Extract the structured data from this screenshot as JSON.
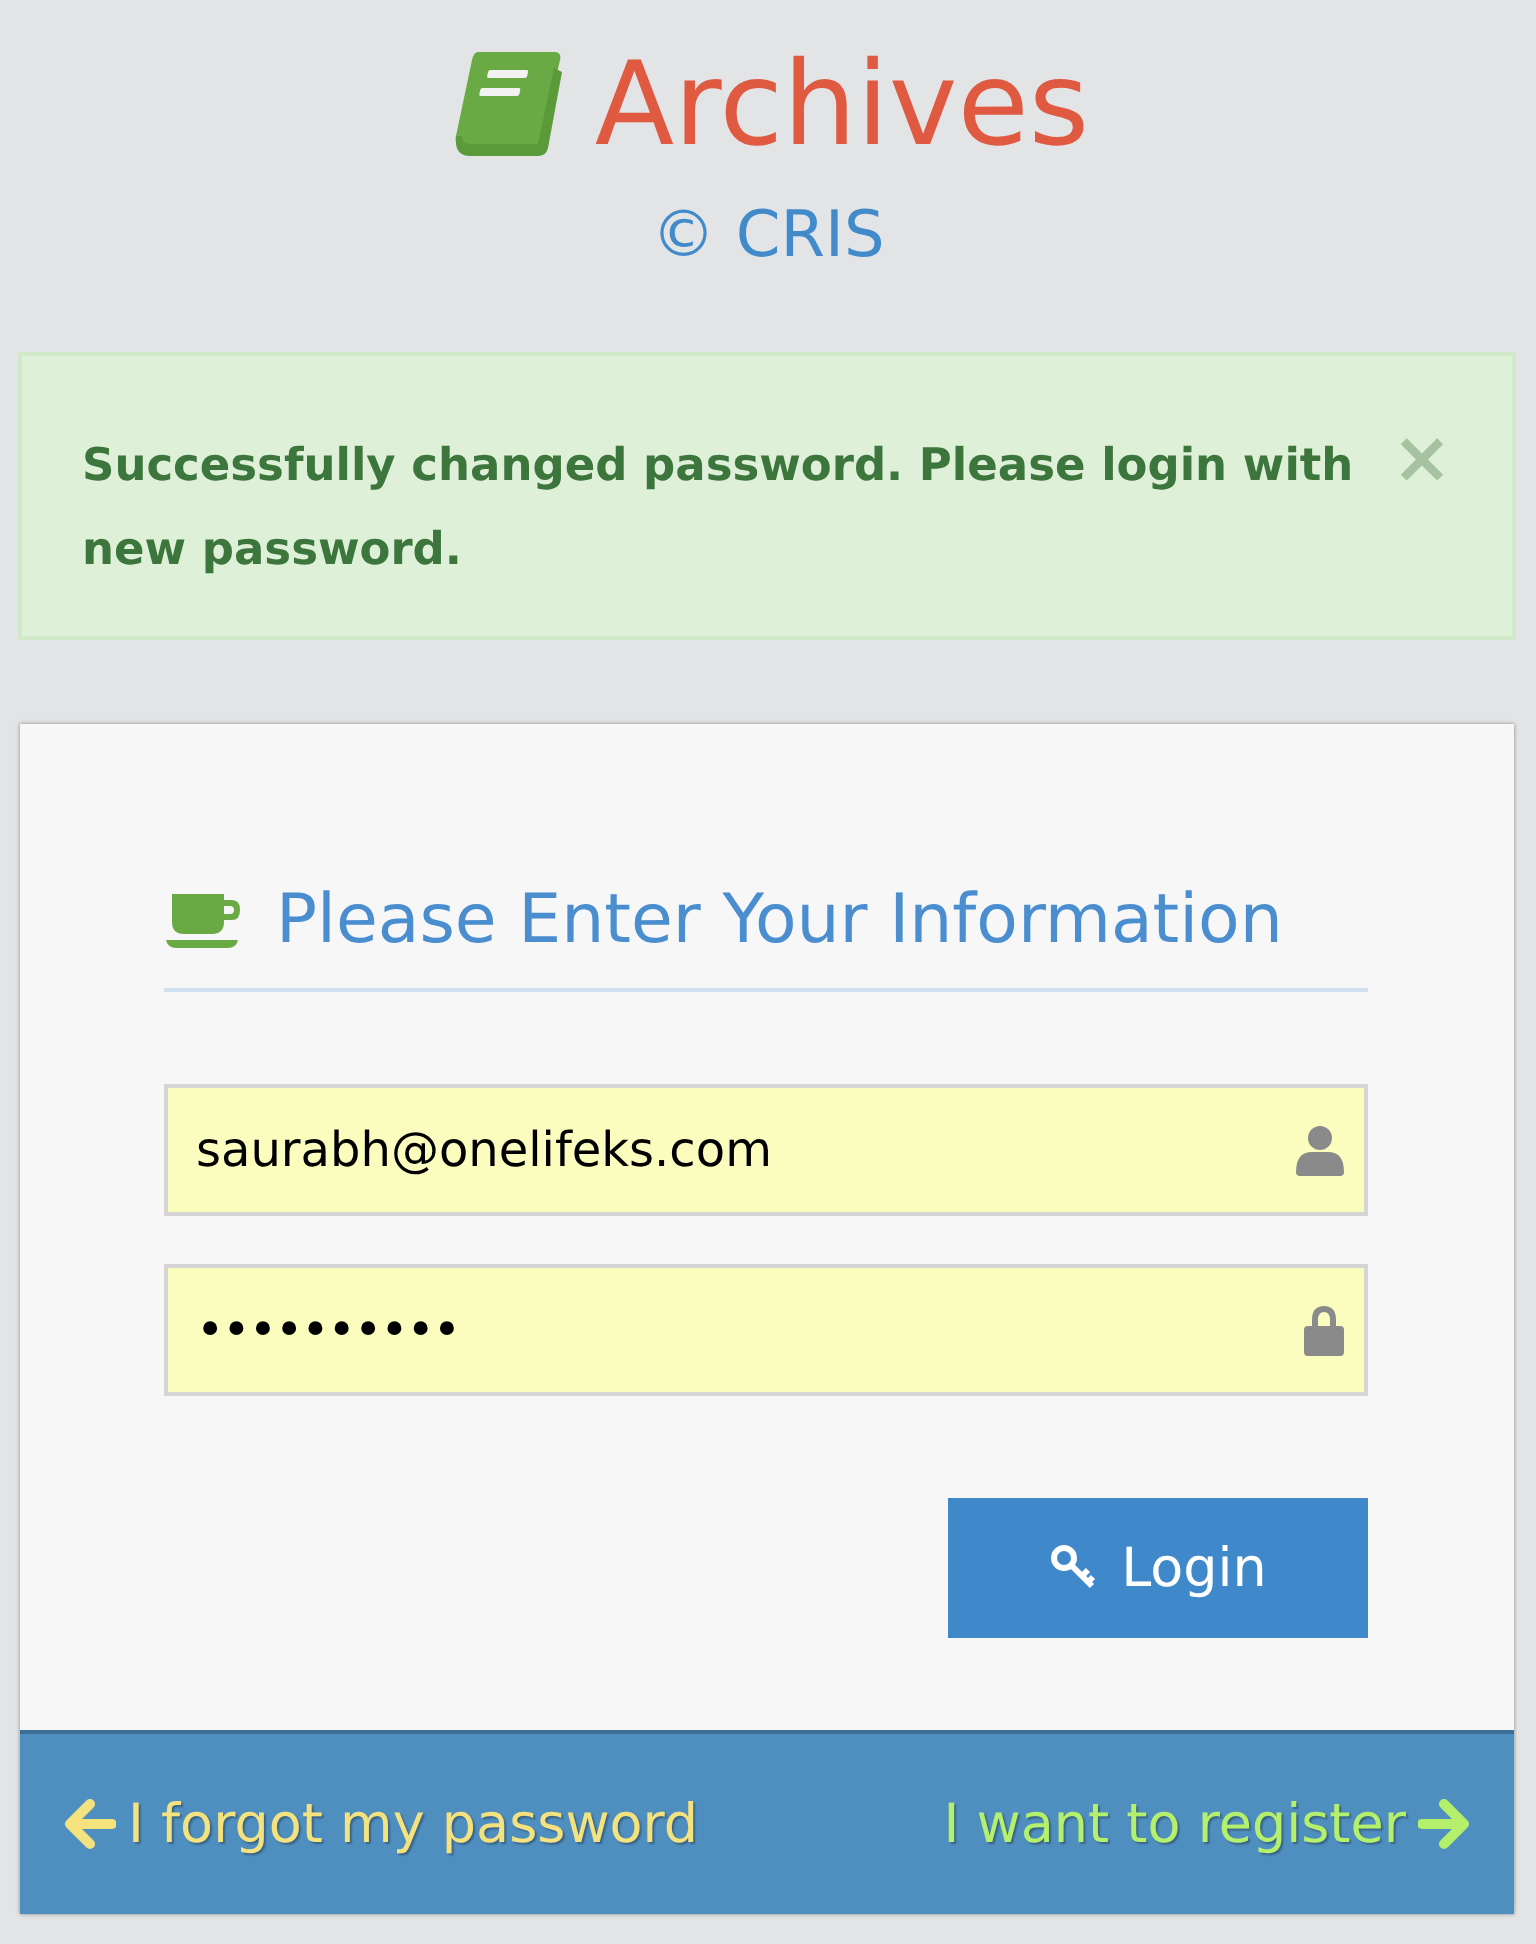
{
  "header": {
    "title": "Archives",
    "subtitle": "© CRIS"
  },
  "alert": {
    "message": "Successfully changed password. Please login with new password.",
    "close": "×"
  },
  "form": {
    "heading": "Please Enter Your Information",
    "fields": [
      {
        "kind": "email",
        "value": "saurabh@onelifeks.com"
      },
      {
        "kind": "password",
        "value": "••••••••••"
      }
    ],
    "button": "Login"
  },
  "footer": {
    "forgot": "I forgot my password",
    "register": "I want to register"
  }
}
